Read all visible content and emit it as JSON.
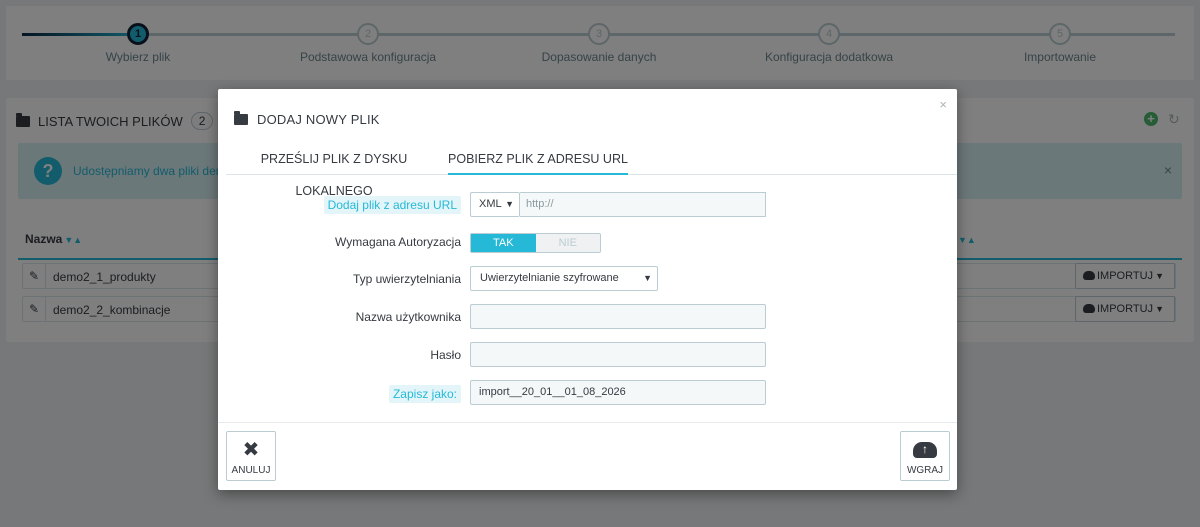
{
  "wizard": {
    "steps": [
      {
        "num": "1",
        "label": "Wybierz plik"
      },
      {
        "num": "2",
        "label": "Podstawowa konfiguracja"
      },
      {
        "num": "3",
        "label": "Dopasowanie danych"
      },
      {
        "num": "4",
        "label": "Konfiguracja dodatkowa"
      },
      {
        "num": "5",
        "label": "Importowanie"
      }
    ]
  },
  "files_panel": {
    "title": "LISTA TWOICH PLIKÓW",
    "count": "2",
    "alert_text": "Udostępniamy dwa pliki demo",
    "alert_close": "×",
    "column_name": "Nazwa",
    "rows": [
      {
        "name": "demo2_1_produkty",
        "action": "IMPORTUJ"
      },
      {
        "name": "demo2_2_kombinacje",
        "action": "IMPORTUJ"
      }
    ]
  },
  "modal": {
    "title": "DODAJ NOWY PLIK",
    "close": "×",
    "tabs": [
      {
        "label": "PRZEŚLIJ PLIK Z DYSKU LOKALNEGO",
        "active": false
      },
      {
        "label": "POBIERZ PLIK Z ADRESU URL",
        "active": true
      }
    ],
    "form": {
      "url_label": "Dodaj plik z adresu URL",
      "format_value": "XML",
      "url_placeholder": "http://",
      "auth_label": "Wymagana Autoryzacja",
      "auth_on": "TAK",
      "auth_off": "NIE",
      "auth_type_label": "Typ uwierzytelniania",
      "auth_type_value": "Uwierzytelnianie szyfrowane",
      "username_label": "Nazwa użytkownika",
      "username_value": "",
      "password_label": "Hasło",
      "password_value": "",
      "save_as_label": "Zapisz jako:",
      "save_as_value": "import__20_01__01_08_2026"
    },
    "footer": {
      "cancel_label": "ANULUJ",
      "upload_label": "WGRAJ"
    }
  }
}
